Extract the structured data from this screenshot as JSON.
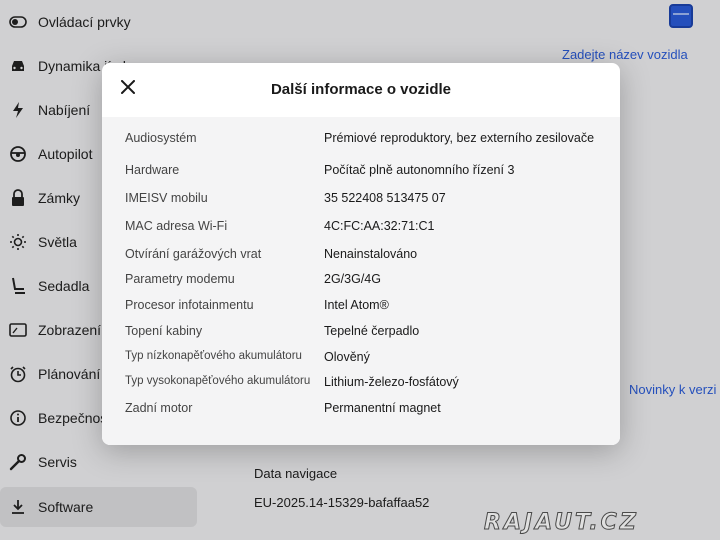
{
  "sidebar": {
    "items": [
      {
        "label": "Ovládací prvky",
        "icon": "toggle-icon"
      },
      {
        "label": "Dynamika jízdy",
        "icon": "car-icon"
      },
      {
        "label": "Nabíjení",
        "icon": "bolt-icon"
      },
      {
        "label": "Autopilot",
        "icon": "steering-wheel-icon"
      },
      {
        "label": "Zámky",
        "icon": "lock-icon"
      },
      {
        "label": "Světla",
        "icon": "sun-icon"
      },
      {
        "label": "Sedadla",
        "icon": "seat-icon"
      },
      {
        "label": "Zobrazení",
        "icon": "display-icon"
      },
      {
        "label": "Plánování",
        "icon": "clock-icon"
      },
      {
        "label": "Bezpečnost",
        "icon": "info-icon"
      },
      {
        "label": "Servis",
        "icon": "wrench-icon"
      },
      {
        "label": "Software",
        "icon": "download-icon"
      }
    ]
  },
  "background": {
    "vehicle_name_link": "Zadejte název vozidla",
    "changes_link": "Novinky k verzi",
    "nav_data_label": "Data navigace",
    "nav_data_value": "EU-2025.14-15329-bafaffaa52"
  },
  "watermark": "RAJAUT.CZ",
  "modal": {
    "title": "Další informace o vozidle",
    "rows": [
      {
        "key": "Audiosystém",
        "value": "Prémiové reproduktory, bez externího zesilovače"
      },
      {
        "key": "Hardware",
        "value": "Počítač plně autonomního řízení 3"
      },
      {
        "key": "IMEISV mobilu",
        "value": "35 522408 513475 07"
      },
      {
        "key": "MAC adresa Wi-Fi",
        "value": "4C:FC:AA:32:71:C1"
      },
      {
        "key": "Otvírání garážových vrat",
        "value": "Nenainstalováno"
      },
      {
        "key": "Parametry modemu",
        "value": "2G/3G/4G"
      },
      {
        "key": "Procesor infotainmentu",
        "value": "Intel Atom®"
      },
      {
        "key": "Topení kabiny",
        "value": "Tepelné čerpadlo"
      },
      {
        "key": "Typ nízkonapěťového akumulátoru",
        "value": "Olověný"
      },
      {
        "key": "Typ vysokonapěťového akumulátoru",
        "value": "Lithium-železo-fosfátový"
      },
      {
        "key": "Zadní motor",
        "value": "Permanentní magnet"
      }
    ]
  },
  "colors": {
    "accent": "#2a5bd7",
    "modal_body": "#f4f4f5"
  }
}
